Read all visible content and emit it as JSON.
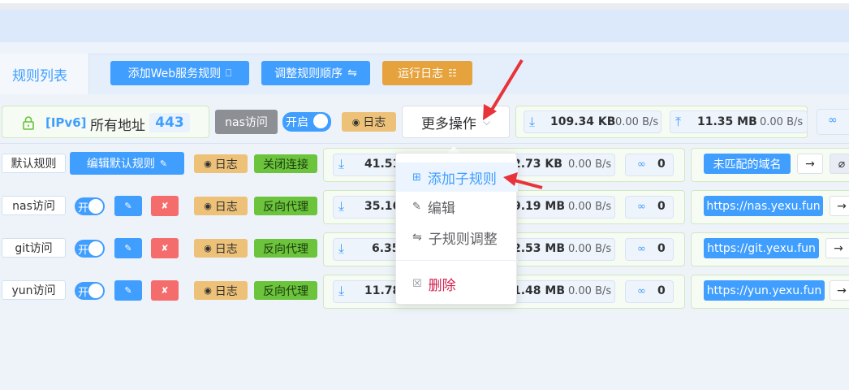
{
  "tabs": {
    "rule_list": "规则列表"
  },
  "toolbar": {
    "add_web_rule": "添加Web服务规则",
    "adjust_order": "调整规则顺序",
    "run_log": "运行日志"
  },
  "main_row": {
    "ipv6": "[IPv6]",
    "all_addr": "所有地址",
    "port": "443",
    "name_tag": "nas访问",
    "toggle_label": "开启",
    "log": "日志",
    "more_ops": "更多操作",
    "download": "109.34 KB",
    "download_speed": "0.00 B/s",
    "upload": "11.35 MB",
    "upload_speed": "0.00 B/s"
  },
  "rules": [
    {
      "name": "默认规则",
      "action": "编辑默认规则",
      "log": "日志",
      "mode": "关闭连接",
      "dl": "41.51",
      "up": "2.73 KB",
      "speed": "0.00 B/s",
      "conn": "0",
      "target": "未匹配的域名"
    },
    {
      "name": "nas访问",
      "toggle": "开",
      "log": "日志",
      "mode": "反向代理",
      "dl": "35.16",
      "up": "9.19 MB",
      "speed": "0.00 B/s",
      "conn": "0",
      "target": "https://nas.yexu.fun"
    },
    {
      "name": "git访问",
      "toggle": "开",
      "log": "日志",
      "mode": "反向代理",
      "dl": "6.35",
      "up": "2.53 MB",
      "speed": "0.00 B/s",
      "conn": "0",
      "target": "https://git.yexu.fun"
    },
    {
      "name": "yun访问",
      "toggle": "开",
      "log": "日志",
      "mode": "反向代理",
      "dl": "11.78",
      "up": "1.48 MB",
      "speed": "0.00 B/s",
      "conn": "0",
      "target": "https://yun.yexu.fun"
    }
  ],
  "menu": {
    "add_sub": "添加子规则",
    "edit": "编辑",
    "adjust_sub": "子规则调整",
    "delete": "删除"
  },
  "colors": {
    "primary": "#409eff",
    "warning": "#e6a23c",
    "success": "#67c23a",
    "danger": "#f56c6c",
    "annotation": "#e8333a"
  }
}
